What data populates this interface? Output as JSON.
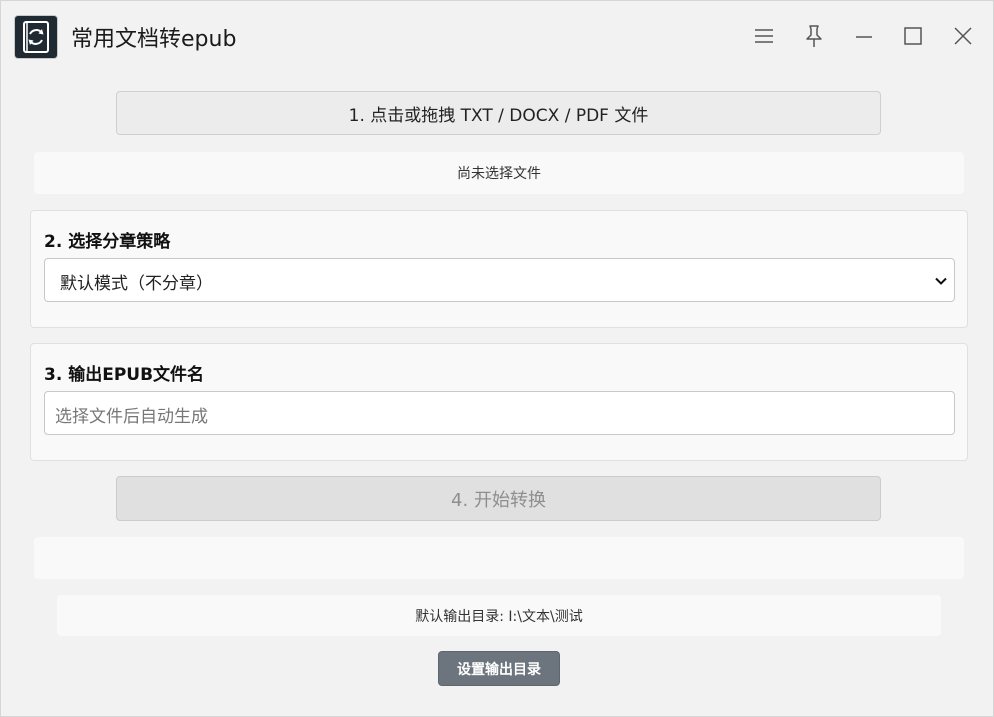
{
  "window": {
    "title": "常用文档转epub",
    "app_icon": "refresh-book-icon",
    "controls": [
      "menu-icon",
      "pin-icon",
      "minimize-icon",
      "maximize-icon",
      "close-icon"
    ]
  },
  "file_select": {
    "button_label": "1. 点击或拖拽 TXT / DOCX / PDF 文件",
    "status_text": "尚未选择文件"
  },
  "strategy": {
    "label": "2. 选择分章策略",
    "selected": "默认模式（不分章）"
  },
  "filename": {
    "label": "3. 输出EPUB文件名",
    "value": "",
    "placeholder": "选择文件后自动生成"
  },
  "convert": {
    "button_label": "4. 开始转换",
    "disabled": true
  },
  "output": {
    "dir_text": "默认输出目录: I:\\文本\\测试",
    "set_dir_label": "设置输出目录"
  },
  "colors": {
    "background": "#f2f2f2",
    "panel": "#f9f9f9",
    "secondary_button": "#6c757d",
    "disabled_text": "#8e8e8e"
  }
}
